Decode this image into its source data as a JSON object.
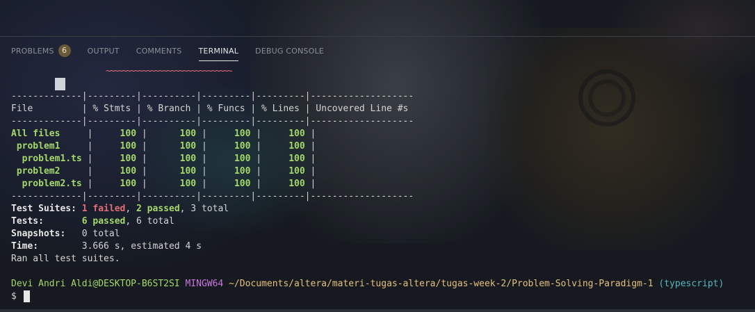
{
  "tabs": {
    "problems": "PROBLEMS",
    "problems_count": "6",
    "output": "OUTPUT",
    "comments": "COMMENTS",
    "terminal": "TERMINAL",
    "debug_console": "DEBUG CONSOLE"
  },
  "coverage": {
    "separator": "-------------|---------|----------|---------|---------|-------------------",
    "header": "File         | % Stmts | % Branch | % Funcs | % Lines | Uncovered Line #s ",
    "rows": [
      {
        "file": "All files    ",
        "stmts": "100",
        "branch": "100",
        "funcs": "100",
        "lines": "100"
      },
      {
        "file": " problem1    ",
        "stmts": "100",
        "branch": "100",
        "funcs": "100",
        "lines": "100"
      },
      {
        "file": "  problem1.ts",
        "stmts": "100",
        "branch": "100",
        "funcs": "100",
        "lines": "100"
      },
      {
        "file": " problem2    ",
        "stmts": "100",
        "branch": "100",
        "funcs": "100",
        "lines": "100"
      },
      {
        "file": "  problem2.ts",
        "stmts": "100",
        "branch": "100",
        "funcs": "100",
        "lines": "100"
      }
    ]
  },
  "summary": {
    "suites_label": "Test Suites:",
    "suites_failed": "1 failed",
    "suites_sep1": ", ",
    "suites_passed": "2 passed",
    "suites_total": ", 3 total",
    "tests_label": "Tests:      ",
    "tests_passed": "6 passed",
    "tests_total": ", 6 total",
    "snapshots_label": "Snapshots:",
    "snapshots_value": "   0 total",
    "time_label": "Time:",
    "time_value": "        3.666 s, estimated 4 s",
    "ran": "Ran all test suites."
  },
  "prompt": {
    "user": "Devi Andri Aldi@DESKTOP-B6ST2SI",
    "system": "MINGW64",
    "path": "~/Documents/altera/materi-tugas-altera/tugas-week-2/Problem-Solving-Paradigm-1",
    "branch": "(typescript)",
    "symbol": "$"
  },
  "colors": {
    "pass": "#a5d86a",
    "fail": "#e06c75",
    "system": "#c678dd",
    "path": "#e5c07b",
    "branch": "#56b6c2"
  }
}
